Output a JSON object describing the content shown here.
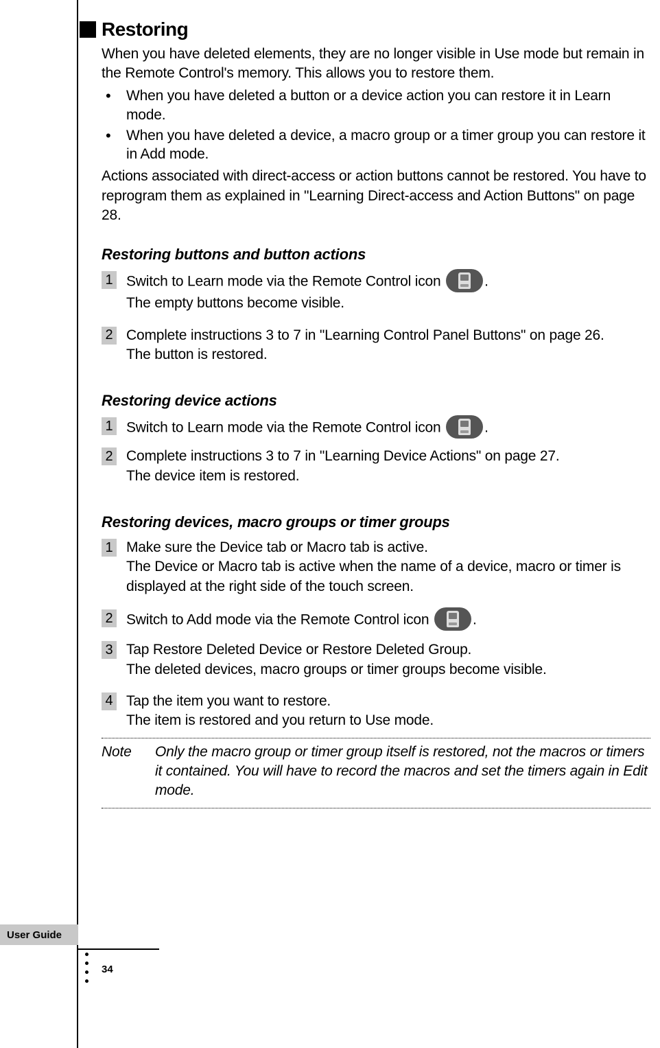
{
  "heading": "Restoring",
  "intro": "When you have deleted elements, they are no longer visible in Use mode but remain in the Remote Control's memory. This allows you to restore them.",
  "bullets": [
    "When you have deleted a button or a device action you can restore it in Learn mode.",
    "When you have deleted a device, a macro group or a timer group you can restore it in Add mode."
  ],
  "after_bullets": "Actions associated with direct-access or action buttons cannot be restored. You have to reprogram them as explained in \"Learning Direct-access and Action Buttons\" on page 28.",
  "sections": [
    {
      "title": "Restoring buttons and button actions",
      "steps": [
        {
          "num": "1",
          "main_pre": "Switch to Learn mode via the Remote Control icon ",
          "icon": true,
          "main_post": ".",
          "sub": "The empty buttons become visible."
        },
        {
          "num": "2",
          "main": "Complete instructions 3 to 7 in \"Learning Control Panel Buttons\" on page 26.",
          "sub": "The button is restored."
        }
      ]
    },
    {
      "title": "Restoring device actions",
      "steps": [
        {
          "num": "1",
          "main_pre": "Switch to Learn mode via the Remote Control icon ",
          "icon": true,
          "main_post": "."
        },
        {
          "num": "2",
          "main": "Complete instructions 3 to 7 in \"Learning Device Actions\" on page 27.",
          "sub": "The device item is restored."
        }
      ]
    },
    {
      "title": "Restoring devices, macro groups or timer groups",
      "steps": [
        {
          "num": "1",
          "main": "Make sure the Device tab or Macro tab is active.",
          "sub": "The Device or Macro tab is active when the name of a device, macro or timer is displayed at the right side of the touch screen."
        },
        {
          "num": "2",
          "main_pre": "Switch to Add mode via the Remote Control icon ",
          "icon": true,
          "main_post": "."
        },
        {
          "num": "3",
          "main": "Tap Restore Deleted Device or Restore Deleted Group.",
          "sub": "The deleted devices, macro groups or timer groups become visible."
        },
        {
          "num": "4",
          "main": "Tap the item you want to restore.",
          "sub": "The item is restored and you return to Use mode."
        }
      ]
    }
  ],
  "note_label": "Note",
  "note_body": "Only the macro group or timer group itself is restored, not the macros or timers it contained. You will have to record the macros and set the timers again in Edit mode.",
  "footer_tab": "User Guide",
  "page_number": "34"
}
